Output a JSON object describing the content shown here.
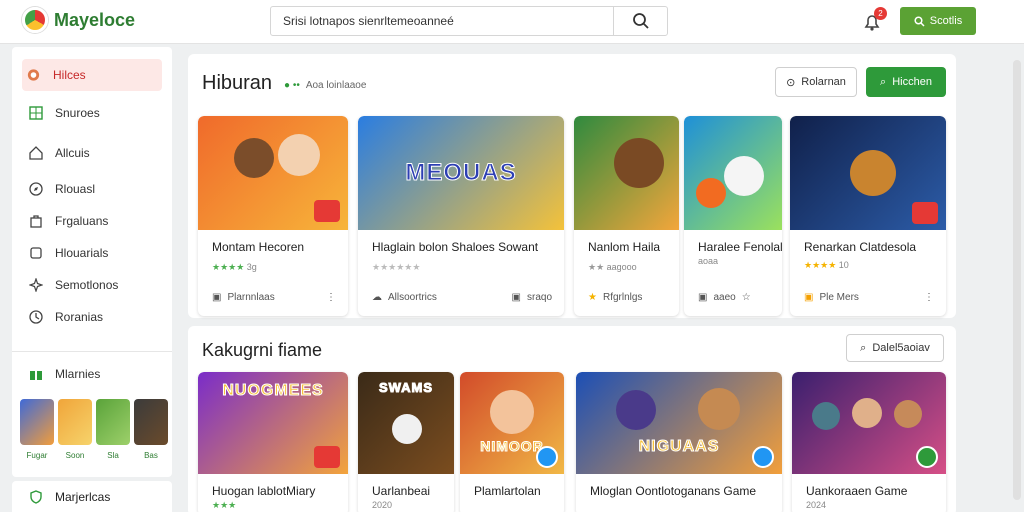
{
  "brand": {
    "name": "Mayeloce"
  },
  "search": {
    "value": "Srisi lotnapos sienrltemeoanneé"
  },
  "header": {
    "notification_count": "2",
    "action_label": "Scotlis"
  },
  "sidebar": {
    "items": [
      {
        "label": "Hilces",
        "icon": "home-icon"
      },
      {
        "label": "Snuroes",
        "icon": "grid-icon"
      },
      {
        "label": "Allcuis",
        "icon": "house-icon"
      },
      {
        "label": "Rlouasl",
        "icon": "compass-icon"
      },
      {
        "label": "Frgaluans",
        "icon": "bag-icon"
      },
      {
        "label": "Hlouarials",
        "icon": "square-icon"
      },
      {
        "label": "Semotlonos",
        "icon": "sparkle-icon"
      },
      {
        "label": "Roranias",
        "icon": "clock-icon"
      }
    ],
    "featured": {
      "label": "Mlarnies",
      "icon": "gift-icon"
    },
    "mini_apps": [
      {
        "label": "Fugar",
        "color": "#3f6ad8"
      },
      {
        "label": "Soon",
        "color": "#f0a53a"
      },
      {
        "label": "Sla",
        "color": "#5aa33a"
      },
      {
        "label": "Bas",
        "color": "#3b3b3b"
      }
    ],
    "bottom": {
      "label": "Marjerlcas",
      "icon": "shield-icon"
    }
  },
  "section1": {
    "title": "Hiburan",
    "breadcrumb": "Aoa  loinlaaoe",
    "btn_outline": "Rolarnan",
    "btn_green": "Hicchen",
    "cards": [
      {
        "title": "Montam Hecoren",
        "meta": "3g",
        "footer": "Plarnnlaas",
        "footer_icon": "doc-icon",
        "thumb": "linear-gradient(135deg,#f06a2b,#f7b53a)",
        "text": "",
        "badge": "red"
      },
      {
        "title": "Hlaglain bolon Shaloes Sowant",
        "meta": "",
        "footer": "Allsoortrics",
        "extra": "sraqo",
        "footer_icon": "cloud-icon",
        "thumb": "linear-gradient(135deg,#2a7de1,#f4c23a)",
        "text": "MEOUAS",
        "badge": ""
      },
      {
        "title": "Nanlom Haila",
        "meta": "aagooo",
        "footer": "Rfgrlnlgs",
        "footer_icon": "star-icon",
        "thumb": "linear-gradient(135deg,#2f8a3e,#f3a63b)",
        "text": "",
        "badge": ""
      },
      {
        "title": "Haralee Fenolale",
        "meta": "aoaa",
        "footer": "aaeo",
        "footer_icon": "doc-icon",
        "thumb": "linear-gradient(135deg,#1e90d8,#9be15d)",
        "text": "",
        "badge": ""
      },
      {
        "title": "Renarkan Clatdesola",
        "meta": "10",
        "footer": "Ple Mers",
        "footer_icon": "bookmark-icon",
        "thumb": "linear-gradient(135deg,#10204a,#2c5ca8)",
        "text": "",
        "badge": "red"
      }
    ]
  },
  "section2": {
    "title": "Kakugrni fiame",
    "btn_outline": "Dalel5aoiav",
    "cards": [
      {
        "title": "Huogan lablotMiary",
        "meta": "",
        "thumb": "linear-gradient(135deg,#7a2cc9,#f3a43b)",
        "text": "NUOGMEES",
        "badge": "red"
      },
      {
        "title": "Uarlanbeai",
        "meta": "2020",
        "thumb": "linear-gradient(135deg,#3a2a18,#7b4d1f)",
        "text": "SWAMS",
        "badge": ""
      },
      {
        "title": "Plamlartolan",
        "meta": "",
        "thumb": "linear-gradient(135deg,#d24b2a,#f1b846)",
        "text": "NIMOOR",
        "badge": "blue"
      },
      {
        "title": "Mloglan Oontlotoganans Game",
        "meta": "",
        "thumb": "linear-gradient(135deg,#1c4fb5,#f29f3b)",
        "text": "NIGUAAS",
        "badge": "blue"
      },
      {
        "title": "Uankoraaen Game",
        "meta": "2024",
        "thumb": "linear-gradient(135deg,#3a1f6e,#d64f86)",
        "text": "",
        "badge": "green"
      }
    ]
  }
}
